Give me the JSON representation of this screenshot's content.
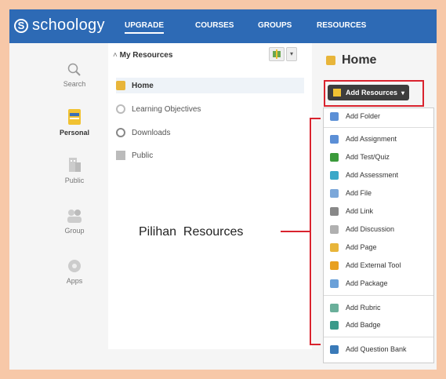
{
  "app": {
    "logo_text": "schoology",
    "logo_letter": "S"
  },
  "topnav": [
    "UPGRADE",
    "COURSES",
    "GROUPS",
    "RESOURCES"
  ],
  "leftnav": [
    {
      "label": "Search",
      "icon": "search-icon"
    },
    {
      "label": "Personal",
      "icon": "personal-icon"
    },
    {
      "label": "Public",
      "icon": "public-icon"
    },
    {
      "label": "Group",
      "icon": "group-icon"
    },
    {
      "label": "Apps",
      "icon": "apps-icon"
    }
  ],
  "resources": {
    "heading": "My Resources",
    "items": [
      "Home",
      "Learning Objectives",
      "Downloads",
      "Public"
    ]
  },
  "main": {
    "title": "Home",
    "add_button": "Add Resources"
  },
  "menu": [
    {
      "label": "Add Folder",
      "color": "#5b8fd6"
    },
    {
      "label": "Add Assignment",
      "color": "#5b8fd6"
    },
    {
      "label": "Add Test/Quiz",
      "color": "#3a9a3a"
    },
    {
      "label": "Add Assessment",
      "color": "#3aa8c8"
    },
    {
      "label": "Add File",
      "color": "#7ba7d9"
    },
    {
      "label": "Add Link",
      "color": "#888888"
    },
    {
      "label": "Add Discussion",
      "color": "#b0b0b0"
    },
    {
      "label": "Add Page",
      "color": "#e8b53a"
    },
    {
      "label": "Add External Tool",
      "color": "#e8a020"
    },
    {
      "label": "Add Package",
      "color": "#6aa0d8"
    },
    {
      "label": "Add Rubric",
      "color": "#6aaf9a"
    },
    {
      "label": "Add Badge",
      "color": "#3a9a8a"
    },
    {
      "label": "Add Question Bank",
      "color": "#3a7ab8"
    }
  ],
  "annotation": "Pilihan  Resources",
  "colors": {
    "topbar": "#2d6ab5",
    "highlight": "#d9232e",
    "button": "#3d3d3d"
  }
}
